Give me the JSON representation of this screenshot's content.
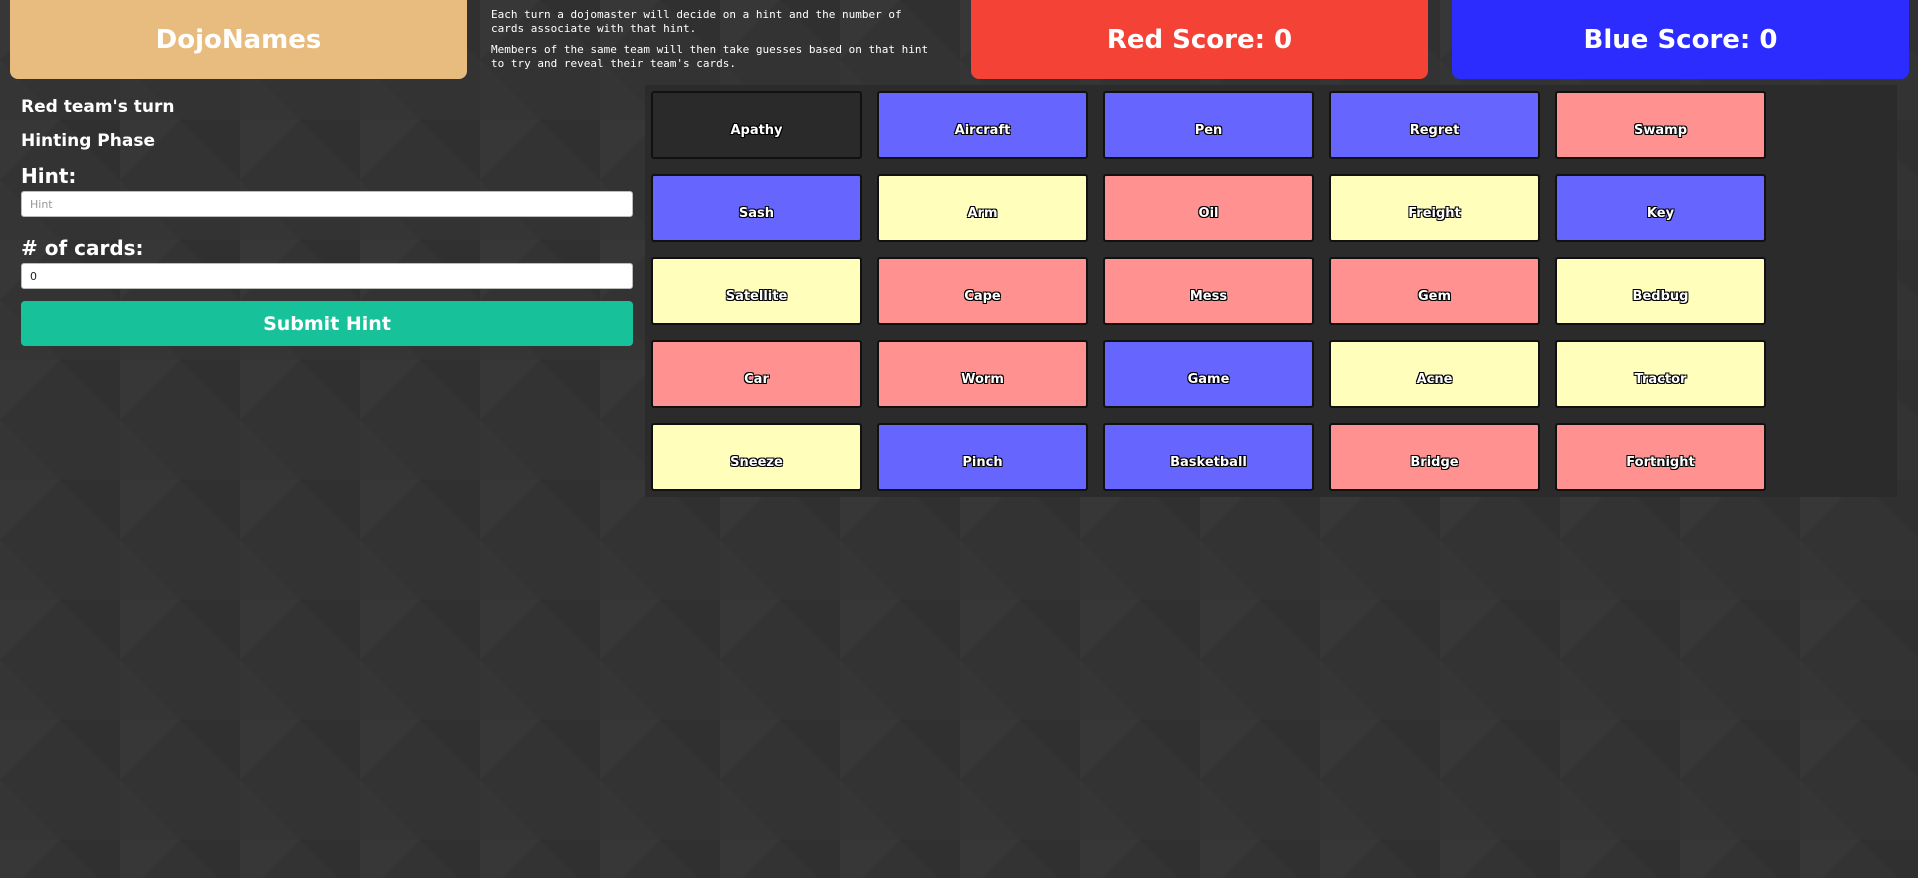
{
  "header": {
    "brand": "DojoNames",
    "instructions": [
      "Each turn a dojomaster will decide on a hint and the number of cards associate with that hint.",
      "Members of the same team will then take guesses based on that hint to try and reveal their team's cards."
    ],
    "red_score": "Red Score: 0",
    "blue_score": "Blue Score: 0"
  },
  "status": {
    "turn": "Red team's turn",
    "phase": "Hinting Phase"
  },
  "form": {
    "hint_label": "Hint:",
    "hint_placeholder": "Hint",
    "hint_value": "",
    "cards_label": "# of cards:",
    "cards_value": "0",
    "submit_label": "Submit Hint"
  },
  "colors": {
    "assassin": "#2a2a2a",
    "blue": "#6666ff",
    "red": "#ff9191",
    "neutral": "#ffffbb",
    "red_score_bg": "#f44336",
    "blue_score_bg": "#2c2cff",
    "brand_bg": "#e8bc7e",
    "submit_bg": "#17c199"
  },
  "cards": [
    {
      "word": "Apathy",
      "team": "assassin"
    },
    {
      "word": "Aircraft",
      "team": "blue"
    },
    {
      "word": "Pen",
      "team": "blue"
    },
    {
      "word": "Regret",
      "team": "blue"
    },
    {
      "word": "Swamp",
      "team": "red"
    },
    {
      "word": "Sash",
      "team": "blue"
    },
    {
      "word": "Arm",
      "team": "neutral"
    },
    {
      "word": "Oil",
      "team": "red"
    },
    {
      "word": "Freight",
      "team": "neutral"
    },
    {
      "word": "Key",
      "team": "blue"
    },
    {
      "word": "Satellite",
      "team": "neutral"
    },
    {
      "word": "Cape",
      "team": "red"
    },
    {
      "word": "Mess",
      "team": "red"
    },
    {
      "word": "Gem",
      "team": "red"
    },
    {
      "word": "Bedbug",
      "team": "neutral"
    },
    {
      "word": "Car",
      "team": "red"
    },
    {
      "word": "Worm",
      "team": "red"
    },
    {
      "word": "Game",
      "team": "blue"
    },
    {
      "word": "Acne",
      "team": "neutral"
    },
    {
      "word": "Tractor",
      "team": "neutral"
    },
    {
      "word": "Sneeze",
      "team": "neutral"
    },
    {
      "word": "Pinch",
      "team": "blue"
    },
    {
      "word": "Basketball",
      "team": "blue"
    },
    {
      "word": "Bridge",
      "team": "red"
    },
    {
      "word": "Fortnight",
      "team": "red"
    }
  ]
}
